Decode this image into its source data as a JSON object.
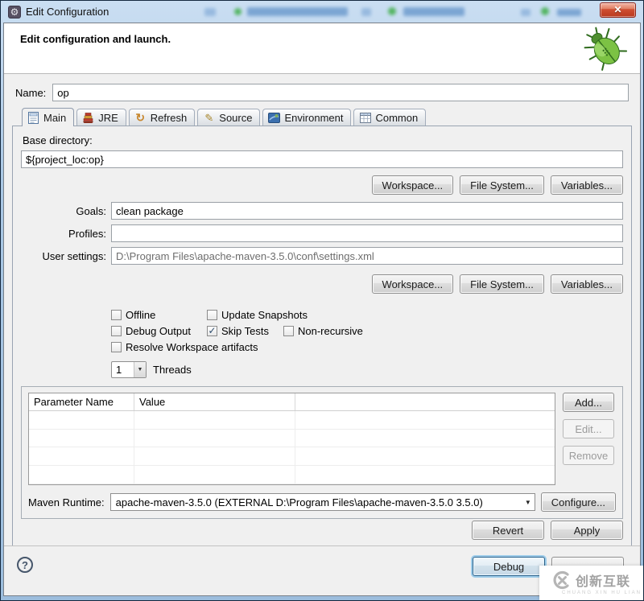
{
  "window": {
    "title": "Edit Configuration",
    "close_glyph": "✕",
    "app_icon": "gear-icon"
  },
  "header": {
    "message": "Edit configuration and launch.",
    "icon": "debug-bug-icon"
  },
  "name_field": {
    "label": "Name:",
    "value": "op"
  },
  "tabs": [
    {
      "label": "Main",
      "icon": "document-icon",
      "selected": true
    },
    {
      "label": "JRE",
      "icon": "jre-books-icon",
      "selected": false
    },
    {
      "label": "Refresh",
      "icon": "refresh-icon",
      "selected": false
    },
    {
      "label": "Source",
      "icon": "source-pencil-icon",
      "selected": false
    },
    {
      "label": "Environment",
      "icon": "environment-icon",
      "selected": false
    },
    {
      "label": "Common",
      "icon": "table-icon",
      "selected": false
    }
  ],
  "main_tab": {
    "base_directory": {
      "label": "Base directory:",
      "value": "${project_loc:op}"
    },
    "dir_buttons": [
      "Workspace...",
      "File System...",
      "Variables..."
    ],
    "goals": {
      "label": "Goals:",
      "value": "clean package"
    },
    "profiles": {
      "label": "Profiles:",
      "value": ""
    },
    "user_settings": {
      "label": "User settings:",
      "value": "D:\\Program Files\\apache-maven-3.5.0\\conf\\settings.xml"
    },
    "checkboxes": [
      {
        "label": "Offline",
        "checked": false
      },
      {
        "label": "Update Snapshots",
        "checked": false
      },
      {
        "label": "Debug Output",
        "checked": false
      },
      {
        "label": "Skip Tests",
        "checked": true
      },
      {
        "label": "Non-recursive",
        "checked": false
      },
      {
        "label": "Resolve Workspace artifacts",
        "checked": false
      }
    ],
    "check_glyph": "✓",
    "threads": {
      "value": "1",
      "label": "Threads"
    },
    "param_table": {
      "columns": [
        "Parameter Name",
        "Value"
      ],
      "rows": []
    },
    "table_buttons": [
      {
        "label": "Add...",
        "enabled": true
      },
      {
        "label": "Edit...",
        "enabled": false
      },
      {
        "label": "Remove",
        "enabled": false
      }
    ],
    "maven_runtime": {
      "label": "Maven Runtime:",
      "value": "apache-maven-3.5.0 (EXTERNAL D:\\Program Files\\apache-maven-3.5.0 3.5.0)",
      "configure_label": "Configure..."
    }
  },
  "actions": {
    "revert": "Revert",
    "apply": "Apply",
    "debug": "Debug"
  },
  "help": {
    "glyph": "?"
  },
  "watermark": {
    "brand": "创新互联",
    "subtext": "CHUANG XIN HU LIAN"
  },
  "colors": {
    "titlebar_blue": "#a9c7e4",
    "close_red": "#c23b28",
    "debug_focus_blue": "#2c628b",
    "bug_green": "#4e9a2e",
    "dialog_gray": "#f0f0f0"
  }
}
